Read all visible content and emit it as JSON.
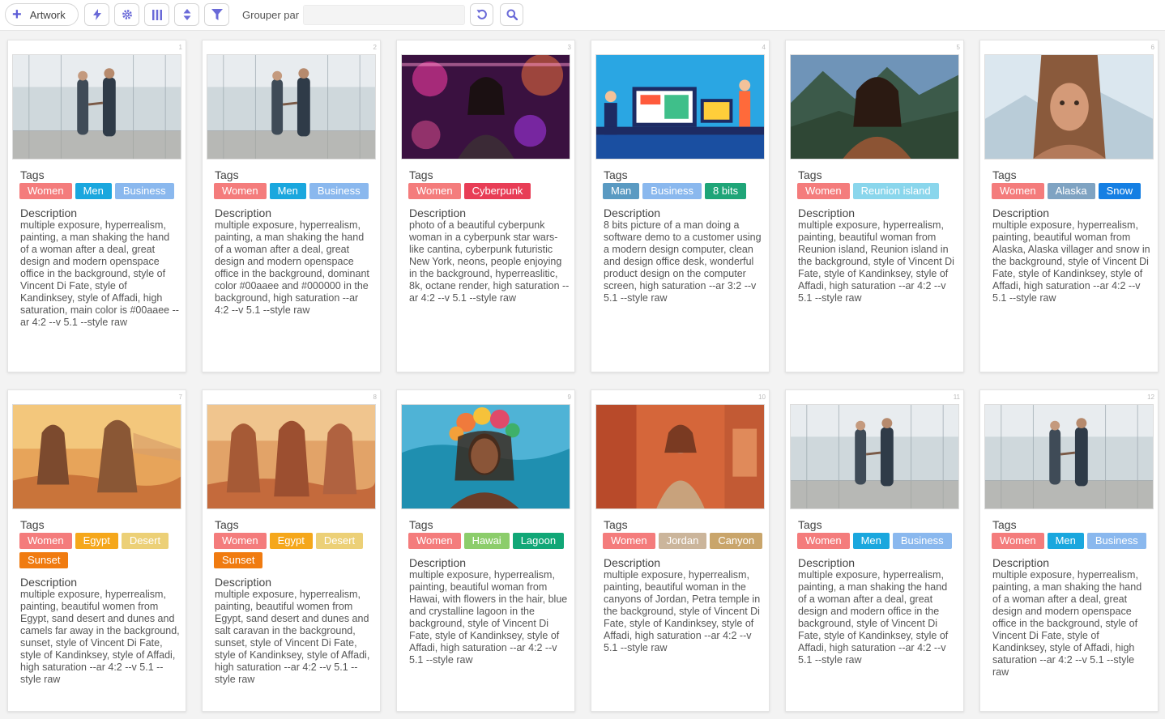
{
  "toolbar": {
    "add_label": "Artwork",
    "group_by_label": "Grouper par",
    "group_by_value": ""
  },
  "labels": {
    "tags": "Tags",
    "description": "Description"
  },
  "colors": {
    "Women": "#f47c7c",
    "Men": "#1aa7de",
    "Business": "#8ab8ee",
    "Cyberpunk": "#e83d56",
    "Man": "#5a9ac2",
    "8 bits": "#1fa578",
    "Reunion island": "#8ad6ec",
    "Alaska": "#7fa3c2",
    "Snow": "#157fe3",
    "Egypt": "#f5a71b",
    "Desert": "#ecd077",
    "Sunset": "#f07b10",
    "Hawai": "#8ccd6b",
    "Lagoon": "#11a777",
    "Jordan": "#cbb59b",
    "Canyon": "#c9a56b"
  },
  "cards": [
    {
      "num": "1",
      "tags": [
        "Women",
        "Men",
        "Business"
      ],
      "image": "business-handshake-image",
      "description": "multiple exposure, hyperrealism, painting, a man shaking the hand of a woman after a deal, great design and modern openspace office in the background, style of Vincent Di Fate, style of Kandinksey, style of Affadi, high saturation, main color is #00aaee --ar 4:2 --v 5.1 --style raw"
    },
    {
      "num": "2",
      "tags": [
        "Women",
        "Men",
        "Business"
      ],
      "image": "business-handshake-image",
      "description": "multiple exposure, hyperrealism, painting, a man shaking the hand of a woman after a deal, great design and modern openspace office in the background, dominant color #00aaee and #000000 in the background, high saturation --ar 4:2 --v 5.1 --style raw"
    },
    {
      "num": "3",
      "tags": [
        "Women",
        "Cyberpunk"
      ],
      "image": "cyberpunk-woman-image",
      "description": "photo of a beautiful cyberpunk woman in a cyberpunk star wars-like cantina, cyberpunk futuristic New York, neons, people enjoying in the background, hyperreaslitic, 8k, octane render, high saturation --ar 4:2 --v 5.1 --style raw"
    },
    {
      "num": "4",
      "tags": [
        "Man",
        "Business",
        "8 bits"
      ],
      "image": "pixel-office-image",
      "description": "8 bits picture of a man doing a software demo to a customer using a modern design computer, clean and design office desk, wonderful product design on the computer screen, high saturation --ar 3:2 --v 5.1 --style raw"
    },
    {
      "num": "5",
      "tags": [
        "Women",
        "Reunion island"
      ],
      "image": "reunion-woman-image",
      "description": "multiple exposure, hyperrealism, painting, beautiful woman from Reunion island, Reunion island in the background, style of Vincent Di Fate, style of Kandinksey, style of Affadi, high saturation --ar 4:2 --v 5.1 --style raw"
    },
    {
      "num": "6",
      "tags": [
        "Women",
        "Alaska",
        "Snow"
      ],
      "image": "alaska-woman-image",
      "description": "multiple exposure, hyperrealism, painting, beautiful woman from Alaska, Alaska villager and snow in the background, style of Vincent Di Fate, style of Kandinksey, style of Affadi, high saturation --ar 4:2 --v 5.1 --style raw"
    },
    {
      "num": "7",
      "tags": [
        "Women",
        "Egypt",
        "Desert",
        "Sunset"
      ],
      "image": "egypt-women-image",
      "description": "multiple exposure, hyperrealism, painting, beautiful women from Egypt, sand desert and dunes and camels far away in the background, sunset, style of Vincent Di Fate, style of Kandinksey, style of Affadi, high saturation --ar 4:2 --v 5.1 --style raw"
    },
    {
      "num": "8",
      "tags": [
        "Women",
        "Egypt",
        "Desert",
        "Sunset"
      ],
      "image": "egypt-caravan-image",
      "description": "multiple exposure, hyperrealism, painting, beautiful women from Egypt, sand desert and dunes and salt caravan in the background, sunset, style of Vincent Di Fate, style of Kandinksey, style of Affadi, high saturation --ar 4:2 --v 5.1 --style raw"
    },
    {
      "num": "9",
      "tags": [
        "Women",
        "Hawai",
        "Lagoon"
      ],
      "image": "hawai-woman-image",
      "description": "multiple exposure, hyperrealism, painting, beautiful woman from Hawai, with flowers in the hair, blue and crystalline lagoon in the background, style of Vincent Di Fate, style of Kandinksey, style of Affadi, high saturation --ar 4:2 --v 5.1 --style raw"
    },
    {
      "num": "10",
      "tags": [
        "Women",
        "Jordan",
        "Canyon"
      ],
      "image": "jordan-woman-image",
      "description": "multiple exposure, hyperrealism, painting, beautiful woman in the canyons of Jordan, Petra temple in the background, style of Vincent Di Fate, style of Kandinksey, style of Affadi, high saturation --ar 4:2 --v 5.1 --style raw"
    },
    {
      "num": "11",
      "tags": [
        "Women",
        "Men",
        "Business"
      ],
      "image": "business-handshake-image",
      "description": "multiple exposure, hyperrealism, painting, a man shaking the hand of a woman after a deal, great design and modern office in the background, style of Vincent Di Fate, style of Kandinksey, style of Affadi, high saturation --ar 4:2 --v 5.1 --style raw"
    },
    {
      "num": "12",
      "tags": [
        "Women",
        "Men",
        "Business"
      ],
      "image": "business-handshake-image",
      "description": "multiple exposure, hyperrealism, painting, a man shaking the hand of a woman after a deal, great design and modern openspace office in the background, style of Vincent Di Fate, style of Kandinksey, style of Affadi, high saturation --ar 4:2 --v 5.1 --style raw"
    }
  ]
}
